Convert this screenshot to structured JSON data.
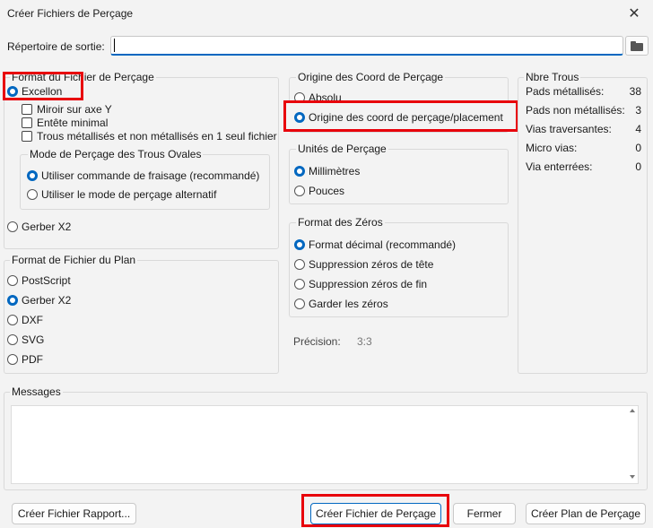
{
  "window": {
    "title": "Créer Fichiers de Perçage",
    "close_glyph": "✕"
  },
  "output": {
    "label": "Répertoire de sortie:",
    "value": ""
  },
  "drill_format": {
    "title": "Format du Fichier de Perçage",
    "excellon": "Excellon",
    "mirror_y": "Miroir sur axe Y",
    "minimal_header": "Entête minimal",
    "pth_npth_single": "Trous métallisés et non métallisés en 1 seul fichier",
    "oval": {
      "title": "Mode de Perçage des Trous Ovales",
      "route_cmd": "Utiliser commande de fraisage (recommandé)",
      "alt_mode": "Utiliser le mode de perçage alternatif"
    },
    "gerber_x2": "Gerber X2"
  },
  "map_format": {
    "title": "Format de Fichier du Plan",
    "options": [
      "PostScript",
      "Gerber X2",
      "DXF",
      "SVG",
      "PDF"
    ],
    "selected": "Gerber X2"
  },
  "origin": {
    "title": "Origine des Coord de Perçage",
    "absolute": "Absolu",
    "aux_origin": "Origine des coord de perçage/placement"
  },
  "units": {
    "title": "Unités de Perçage",
    "mm": "Millimètres",
    "inches": "Pouces"
  },
  "zeros": {
    "title": "Format des Zéros",
    "decimal": "Format décimal (recommandé)",
    "suppress_leading": "Suppression zéros de tête",
    "suppress_trailing": "Suppression zéros de fin",
    "keep": "Garder les zéros"
  },
  "precision": {
    "label": "Précision:",
    "value": "3:3"
  },
  "holes": {
    "title": "Nbre Trous",
    "plated_label": "Pads métallisés:",
    "plated": "38",
    "npth_label": "Pads non métallisés:",
    "npth": "3",
    "through_vias_label": "Vias traversantes:",
    "through_vias": "4",
    "micro_vias_label": "Micro vias:",
    "micro_vias": "0",
    "buried_vias_label": "Via enterrées:",
    "buried_vias": "0"
  },
  "messages": {
    "title": "Messages"
  },
  "buttons": {
    "report": "Créer Fichier Rapport...",
    "generate": "Créer Fichier de Perçage",
    "close": "Fermer",
    "map": "Créer Plan de Perçage"
  },
  "colors": {
    "accent": "#0067c0",
    "highlight": "#e8000b"
  },
  "icons": [
    "close-icon",
    "folder-icon"
  ]
}
